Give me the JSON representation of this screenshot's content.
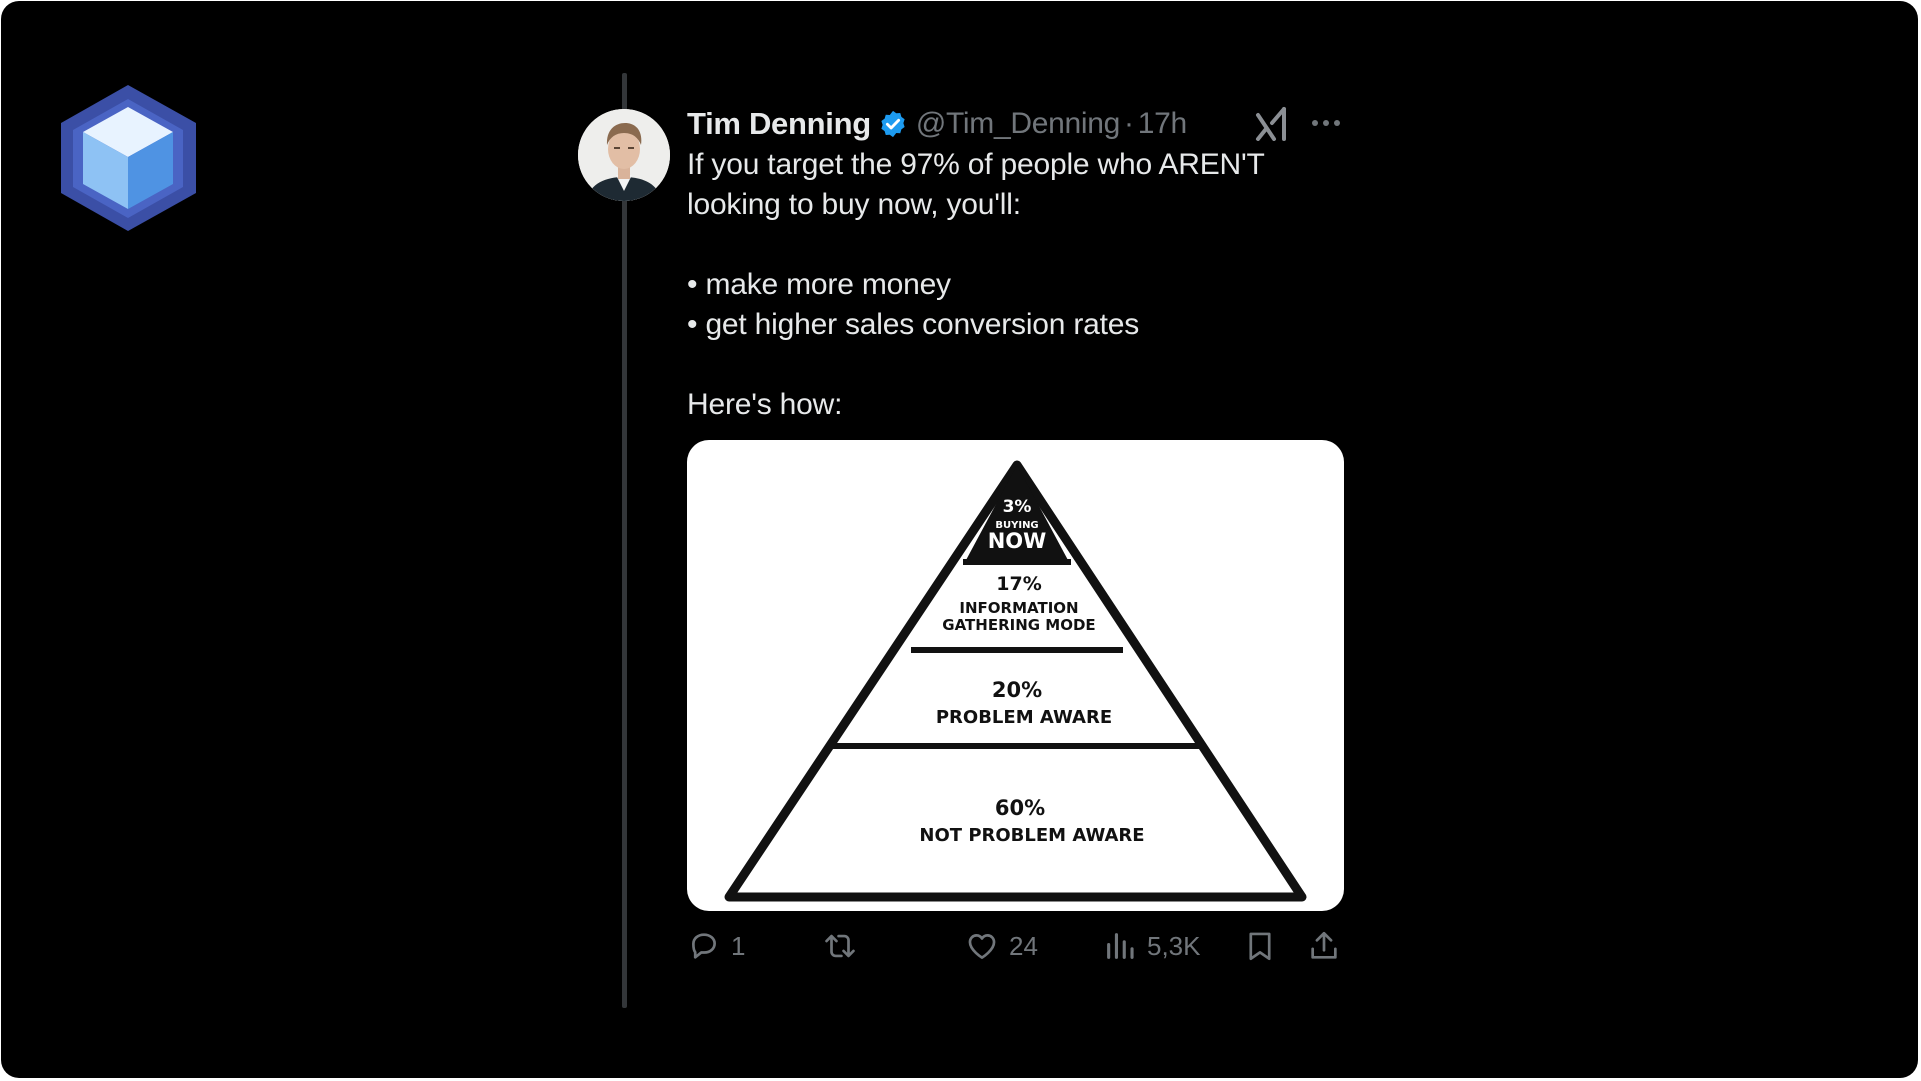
{
  "tweet": {
    "author": {
      "name": "Tim Denning",
      "handle": "@Tim_Denning",
      "verified": true
    },
    "separator": "·",
    "time": "17h",
    "text_lines": [
      "If you target the 97% of people who AREN'T looking to buy now, you'll:",
      "",
      "• make more money",
      "• get higher sales conversion rates",
      "",
      "Here's how:"
    ],
    "media": {
      "type": "pyramid-diagram",
      "tiers": [
        {
          "percent": "3%",
          "label_small": "BUYING",
          "label": "NOW"
        },
        {
          "percent": "17%",
          "label_line1": "INFORMATION",
          "label_line2": "GATHERING MODE"
        },
        {
          "percent": "20%",
          "label": "PROBLEM AWARE"
        },
        {
          "percent": "60%",
          "label": "NOT PROBLEM AWARE"
        }
      ]
    },
    "actions": {
      "reply": {
        "icon": "reply-icon",
        "count": "1"
      },
      "repost": {
        "icon": "repost-icon",
        "count": ""
      },
      "like": {
        "icon": "heart-icon",
        "count": "24"
      },
      "views": {
        "icon": "views-icon",
        "count": "5,3K"
      },
      "bookmark": {
        "icon": "bookmark-icon"
      },
      "share": {
        "icon": "share-icon"
      }
    }
  },
  "colors": {
    "background": "#000000",
    "text_primary": "#e7e9ea",
    "text_secondary": "#71767b",
    "verified_blue": "#1d9bf0",
    "thread_line": "#333639"
  }
}
